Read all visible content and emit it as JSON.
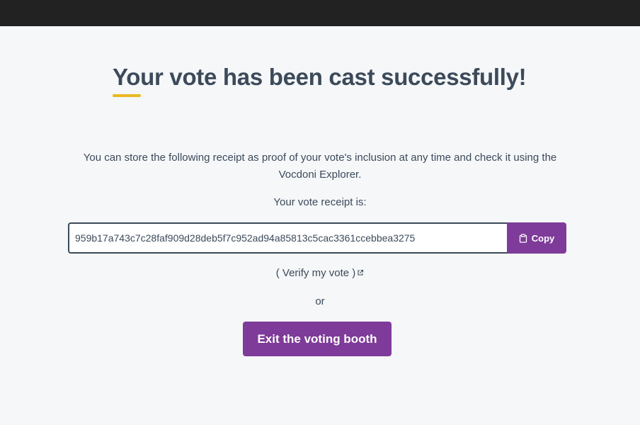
{
  "page": {
    "title": "Your vote has been cast successfully!",
    "description": "You can store the following receipt as proof of your vote's inclusion at any time and check it using the Vocdoni Explorer.",
    "receipt_label": "Your vote receipt is:",
    "receipt_value": "959b17a743c7c28faf909d28deb5f7c952ad94a85813c5cac3361ccebbea3275",
    "copy_label": "Copy",
    "verify_label": "( Verify my vote )",
    "or_label": "or",
    "exit_label": "Exit the voting booth"
  },
  "colors": {
    "topbar": "#222222",
    "accent": "#7e3b99",
    "underline": "#e8b923",
    "text": "#3c4a5a",
    "background": "#f5f7f9"
  },
  "icons": {
    "copy": "clipboard-icon",
    "verify": "external-link-icon"
  }
}
